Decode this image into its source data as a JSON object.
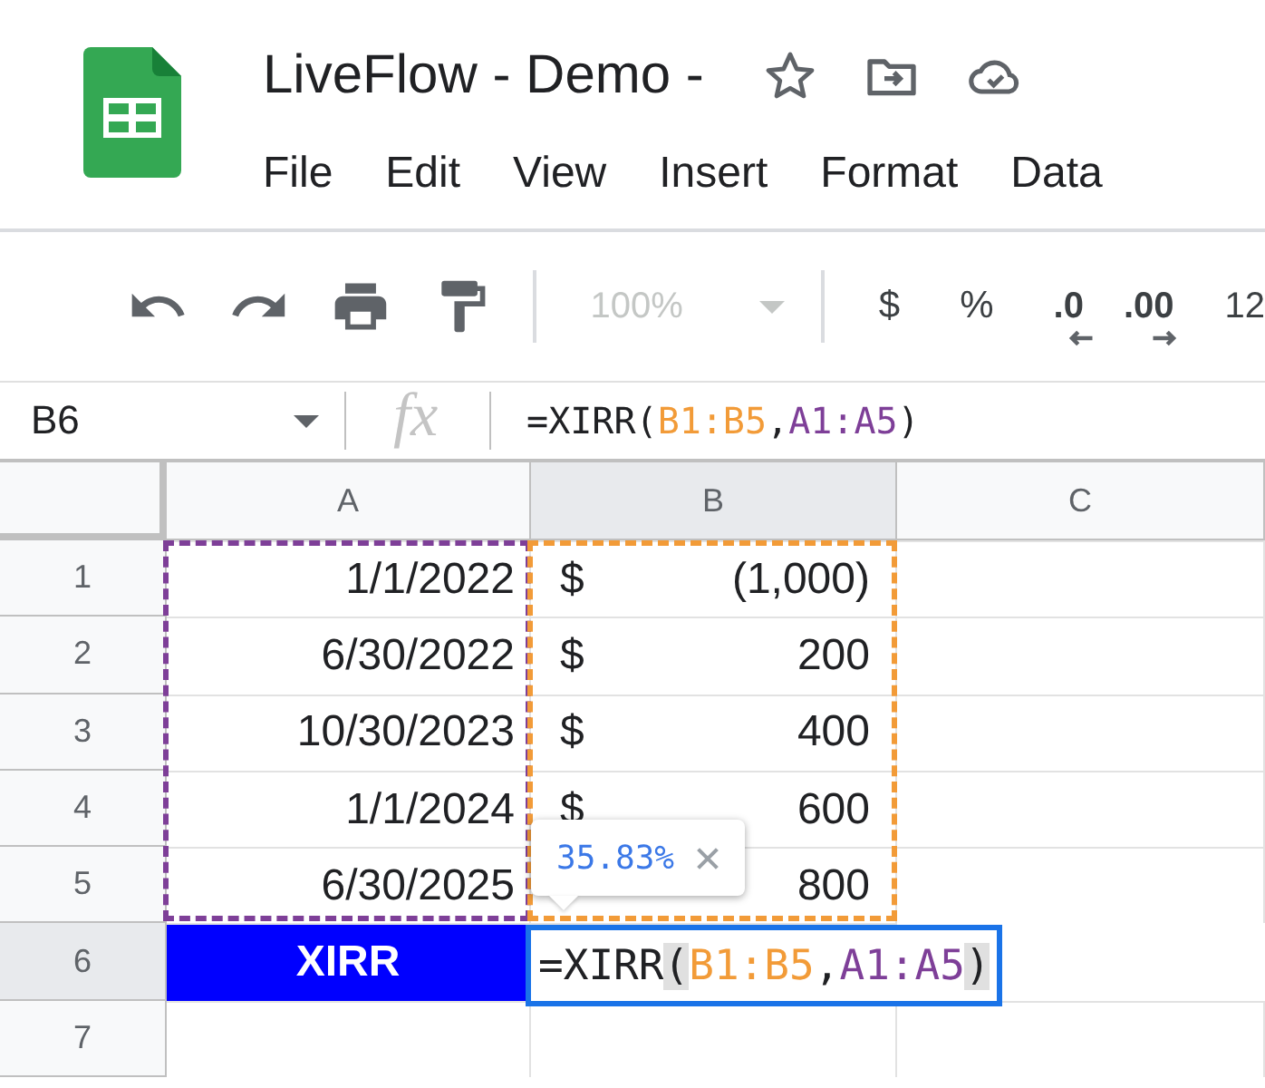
{
  "document": {
    "title": "LiveFlow - Demo -"
  },
  "menu": [
    "File",
    "Edit",
    "View",
    "Insert",
    "Format",
    "Data"
  ],
  "toolbar": {
    "zoom": {
      "value": "100%",
      "disabled": true
    },
    "currency": "$",
    "percent": "%",
    "decrease_decimals": ".0",
    "increase_decimals": ".00",
    "number_format": "12"
  },
  "name_box": "B6",
  "fx_label": "fx",
  "formula": [
    {
      "text": "=XIRR",
      "kind": "fn"
    },
    {
      "text": "(",
      "kind": "paren"
    },
    {
      "text": "B1:B5",
      "kind": "range",
      "color": "#f29b38"
    },
    {
      "text": ",",
      "kind": "sep"
    },
    {
      "text": "A1:A5",
      "kind": "range",
      "color": "#7e3f98"
    },
    {
      "text": ")",
      "kind": "paren"
    }
  ],
  "columns": [
    {
      "label": "A",
      "selected": false,
      "color": "#7e3f98"
    },
    {
      "label": "B",
      "selected": true,
      "color": "#f29b38"
    },
    {
      "label": "C",
      "selected": false
    }
  ],
  "rows": [
    {
      "label": "1",
      "selected": false,
      "in_range": true,
      "date": "1/1/2022",
      "symbol": "$",
      "amount": "(1,000)"
    },
    {
      "label": "2",
      "selected": false,
      "in_range": true,
      "date": "6/30/2022",
      "symbol": "$",
      "amount": "200"
    },
    {
      "label": "3",
      "selected": false,
      "in_range": true,
      "date": "10/30/2023",
      "symbol": "$",
      "amount": "400"
    },
    {
      "label": "4",
      "selected": false,
      "in_range": true,
      "date": "1/1/2024",
      "symbol": "$",
      "amount": "600"
    },
    {
      "label": "5",
      "selected": false,
      "in_range": true,
      "date": "6/30/2025",
      "amount": "800"
    },
    {
      "label": "6",
      "selected": true,
      "in_range": false,
      "kind": "result",
      "label_cell": "XIRR",
      "editing": true,
      "cell_formula": [
        {
          "text": "=XIRR",
          "kind": "fn"
        },
        {
          "text": "(",
          "kind": "paren"
        },
        {
          "text": "B1:B5",
          "kind": "range",
          "color": "#f29b38"
        },
        {
          "text": ",",
          "kind": "sep"
        },
        {
          "text": "A1:A5",
          "kind": "range",
          "color": "#7e3f98"
        },
        {
          "text": ")",
          "kind": "paren"
        }
      ]
    },
    {
      "label": "7",
      "selected": false,
      "in_range": false
    }
  ],
  "preview": {
    "value": "35.83%"
  }
}
